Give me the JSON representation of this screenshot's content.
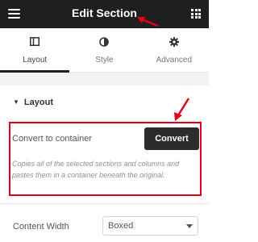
{
  "header": {
    "title": "Edit Section",
    "menu_icon": "hamburger-icon",
    "apps_icon": "grid-icon"
  },
  "tabs": [
    {
      "label": "Layout",
      "icon": "layout-icon",
      "active": true
    },
    {
      "label": "Style",
      "icon": "half-circle-icon",
      "active": false
    },
    {
      "label": "Advanced",
      "icon": "gear-icon",
      "active": false
    }
  ],
  "layout_section": {
    "title": "Layout",
    "expanded": true
  },
  "convert": {
    "label": "Convert to container",
    "button_label": "Convert",
    "description": "Copies all of the selected sections and columns and pastes them in a container beneath the original."
  },
  "content_width": {
    "label": "Content Width",
    "value": "Boxed"
  },
  "colors": {
    "header_bg": "#1f1f1f",
    "annotation_red": "#e3001b",
    "button_bg": "#2c2c2c"
  }
}
